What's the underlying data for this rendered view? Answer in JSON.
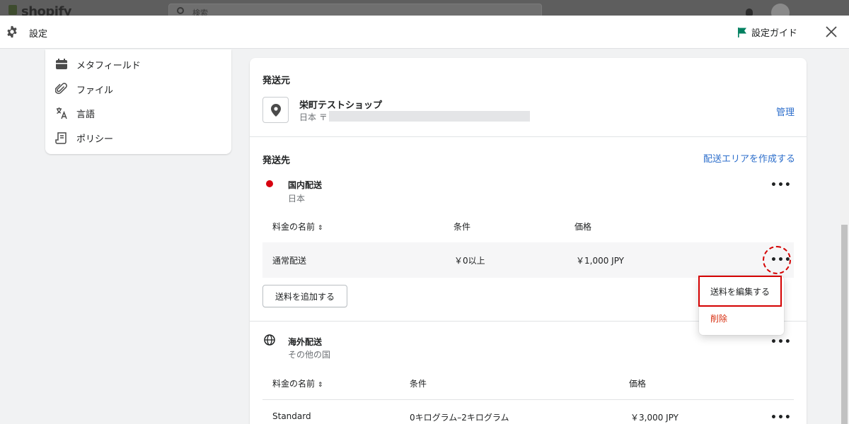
{
  "topbar": {
    "logo": "shopify",
    "search_placeholder": "検索"
  },
  "header": {
    "title": "設定",
    "guide_label": "設定ガイド"
  },
  "sidebar": {
    "items": [
      {
        "label": "メタフィールド",
        "icon": "metafield-icon"
      },
      {
        "label": "ファイル",
        "icon": "paperclip-icon"
      },
      {
        "label": "言語",
        "icon": "translate-icon"
      },
      {
        "label": "ポリシー",
        "icon": "policy-icon"
      }
    ]
  },
  "origin": {
    "title": "発送元",
    "location_name": "栄町テストショップ",
    "location_address": "日本 〒",
    "manage_link": "管理"
  },
  "destination": {
    "title": "発送先",
    "create_zone_link": "配送エリアを作成する",
    "zones": [
      {
        "name": "国内配送",
        "region": "日本",
        "headers": {
          "rate_name": "料金の名前",
          "condition": "条件",
          "price": "価格"
        },
        "rates": [
          {
            "name": "通常配送",
            "condition": "￥0以上",
            "price": "￥1,000 JPY"
          }
        ],
        "add_rate_label": "送料を追加する"
      },
      {
        "name": "海外配送",
        "region": "その他の国",
        "headers": {
          "rate_name": "料金の名前",
          "condition": "条件",
          "price": "価格"
        },
        "rates": [
          {
            "name": "Standard",
            "condition": "0キログラム–2キログラム",
            "price": "￥3,000 JPY"
          }
        ]
      }
    ]
  },
  "popup_menu": {
    "items": [
      {
        "label": "送料を編集する",
        "color": "#202223"
      },
      {
        "label": "削除",
        "color": "#d72c0d"
      }
    ]
  },
  "colors": {
    "link": "#2c6ecb",
    "zone_dot": "#d7000f",
    "highlight": "#d40000",
    "guide_flag": "#008060"
  }
}
